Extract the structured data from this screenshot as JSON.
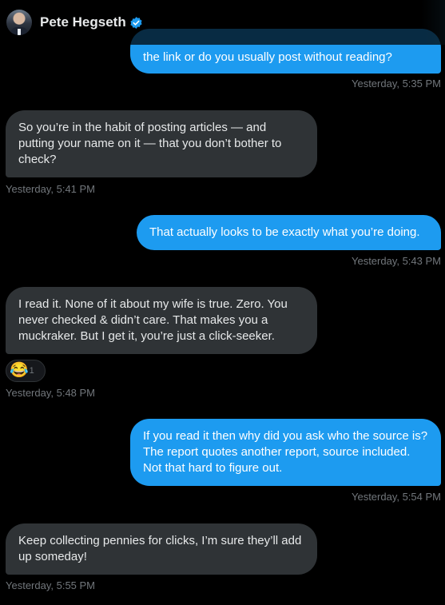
{
  "header": {
    "name": "Pete Hegseth"
  },
  "messages": [
    {
      "text": "the link or do you usually post without reading?",
      "time": "Yesterday, 5:35 PM"
    },
    {
      "text": "So you’re in the habit of posting articles — and putting your name on it — that you don’t bother to check?",
      "time": "Yesterday, 5:41 PM"
    },
    {
      "text": "That actually looks to be exactly what you’re doing.",
      "time": "Yesterday, 5:43 PM"
    },
    {
      "text": "I read it. None of it about my wife is true. Zero. You never checked & didn’t care. That makes you a muckraker. But I get it, you’re just a click-seeker.",
      "time": "Yesterday, 5:48 PM",
      "reaction": {
        "emoji": "😂",
        "count": "1"
      }
    },
    {
      "text": "If you read it then why did you ask who the source is? The report quotes another report, source included. Not that hard to figure out.",
      "time": "Yesterday, 5:54 PM"
    },
    {
      "text": "Keep collecting pennies for clicks, I’m sure they’ll add up someday!",
      "time": "Yesterday, 5:55 PM"
    }
  ]
}
